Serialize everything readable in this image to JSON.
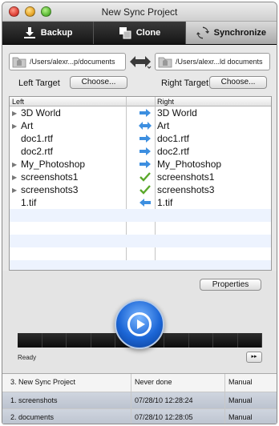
{
  "window": {
    "title": "New Sync Project"
  },
  "toolbar": {
    "buttons": [
      {
        "label": "Backup",
        "icon": "download-arrow-icon",
        "active": false
      },
      {
        "label": "Clone",
        "icon": "clone-icon",
        "active": false
      },
      {
        "label": "Synchronize",
        "icon": "sync-icon",
        "active": true
      }
    ]
  },
  "targets": {
    "left_path": "/Users/alexr...p/documents",
    "right_path": "/Users/alexr...ld documents",
    "left_label": "Left Target",
    "right_label": "Right Target",
    "choose_label": "Choose..."
  },
  "table": {
    "header_left": "Left",
    "header_right": "Right",
    "rows": [
      {
        "left": "3D World",
        "right": "3D World",
        "action": "right",
        "folder": true
      },
      {
        "left": "Art",
        "right": "Art",
        "action": "both",
        "folder": true
      },
      {
        "left": "doc1.rtf",
        "right": "doc1.rtf",
        "action": "right",
        "folder": false
      },
      {
        "left": "doc2.rtf",
        "right": "doc2.rtf",
        "action": "right",
        "folder": false
      },
      {
        "left": "My_Photoshop",
        "right": "My_Photoshop",
        "action": "right",
        "folder": true
      },
      {
        "left": "screenshots1",
        "right": "screenshots1",
        "action": "check",
        "folder": true
      },
      {
        "left": "screenshots3",
        "right": "screenshots3",
        "action": "check",
        "folder": true
      },
      {
        "left": "1.tif",
        "right": "1.tif",
        "action": "left",
        "folder": false
      }
    ]
  },
  "controls": {
    "properties_label": "Properties",
    "status": "Ready",
    "fast_forward_label": "▸▸"
  },
  "projects": [
    {
      "name": "3. New Sync Project",
      "last": "Never done",
      "mode": "Manual"
    },
    {
      "name": "1. screenshots",
      "last": "07/28/10 12:28:24",
      "mode": "Manual"
    },
    {
      "name": "2. documents",
      "last": "07/28/10 12:28:05",
      "mode": "Manual"
    }
  ],
  "colors": {
    "arrow_blue": "#3d8fe0",
    "check_green": "#5aa82a",
    "selection": "#c4cad6"
  }
}
